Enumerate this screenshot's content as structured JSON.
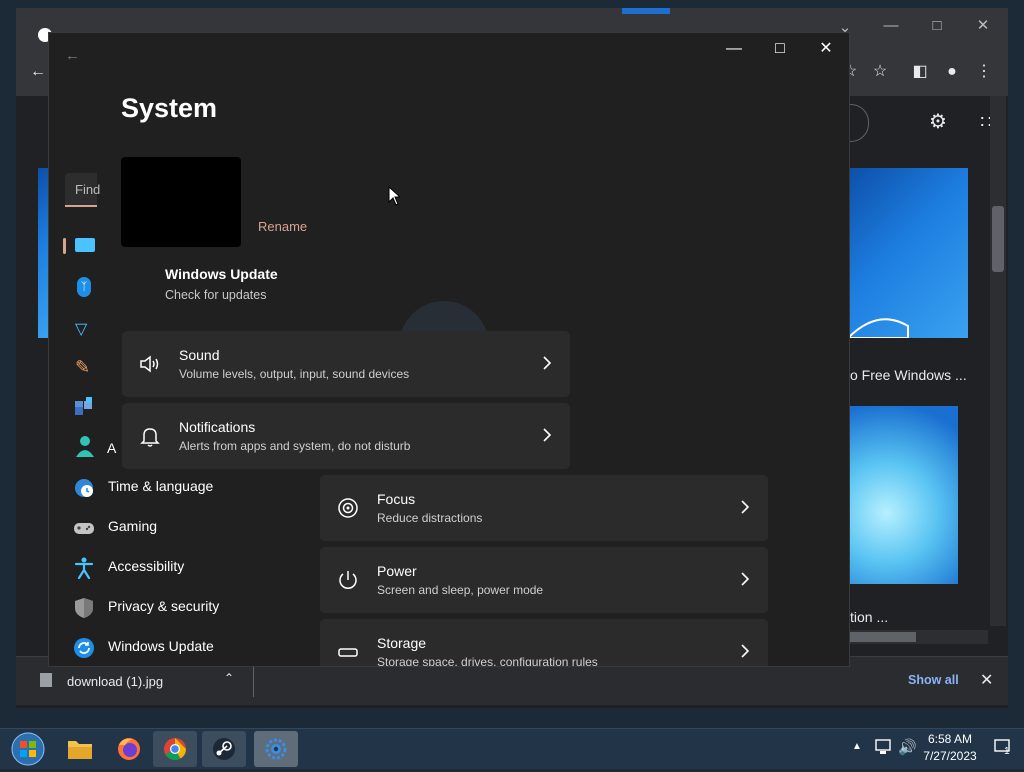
{
  "settings": {
    "title": "System",
    "rename_label": "Rename",
    "windows_update": {
      "title": "Windows Update",
      "subtitle": "Check for updates"
    },
    "search_placeholder": "Find",
    "cards": [
      {
        "title": "Sound",
        "subtitle": "Volume levels, output, input, sound devices",
        "icon": "speaker-icon"
      },
      {
        "title": "Notifications",
        "subtitle": "Alerts from apps and system, do not disturb",
        "icon": "bell-icon"
      },
      {
        "title": "Focus",
        "subtitle": "Reduce distractions",
        "icon": "focus-icon"
      },
      {
        "title": "Power",
        "subtitle": "Screen and sleep, power mode",
        "icon": "power-icon"
      },
      {
        "title": "Storage",
        "subtitle": "Storage space, drives, configuration rules",
        "icon": "storage-icon"
      }
    ],
    "nav": [
      {
        "label": "Time & language",
        "icon": "globe-clock-icon"
      },
      {
        "label": "Gaming",
        "icon": "gamepad-icon"
      },
      {
        "label": "Accessibility",
        "icon": "accessibility-icon"
      },
      {
        "label": "Privacy & security",
        "icon": "shield-icon"
      },
      {
        "label": "Windows Update",
        "icon": "update-icon"
      }
    ],
    "accounts_partial": "A"
  },
  "browser": {
    "captions": [
      "o Free Windows ...",
      "tion ..."
    ],
    "download": {
      "filename": "download (1).jpg",
      "show_all": "Show all"
    }
  },
  "taskbar": {
    "time": "6:58 AM",
    "date": "7/27/2023",
    "notification_count": "1",
    "apps": [
      "start-orb",
      "file-explorer",
      "firefox",
      "chrome",
      "steam",
      "settings"
    ]
  },
  "colors": {
    "settings_bg": "#202020",
    "card_bg": "#2b2b2b",
    "accent_link": "#d8a48f",
    "accent_blue": "#4cc2ff",
    "chrome_bg": "#202124",
    "taskbar_bg": "#223548"
  }
}
